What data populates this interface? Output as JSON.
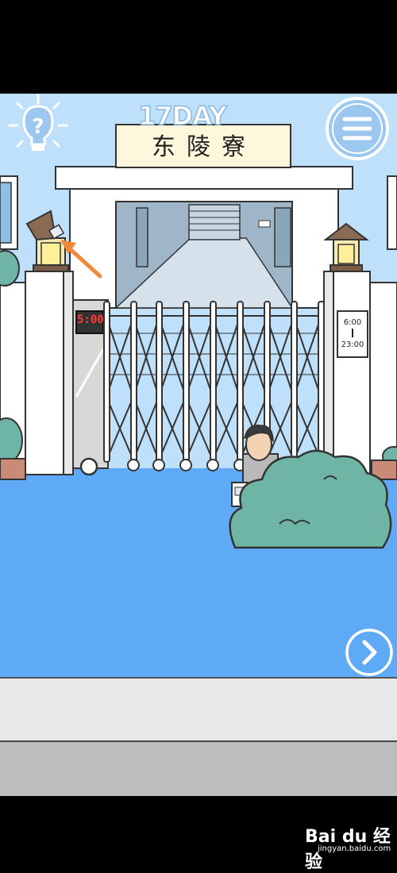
{
  "game": {
    "day_label": "17DAY",
    "building_sign": "东陵寮",
    "gate_timer": "5:00",
    "opening_hours": {
      "open": "6:00",
      "close": "23:00"
    }
  },
  "buttons": {
    "hint": "hint-lightbulb-icon",
    "menu": "hamburger-menu-icon",
    "next": "chevron-right-icon"
  },
  "colors": {
    "sky": "#bfe0fb",
    "ground": "#5eaaf6",
    "bush": "#6fb5a5",
    "arrow": "#f08a3a",
    "timer_led": "#ff3b3b"
  },
  "watermark": {
    "logo": "Bai du 经验",
    "url": "jingyan.baidu.com"
  }
}
